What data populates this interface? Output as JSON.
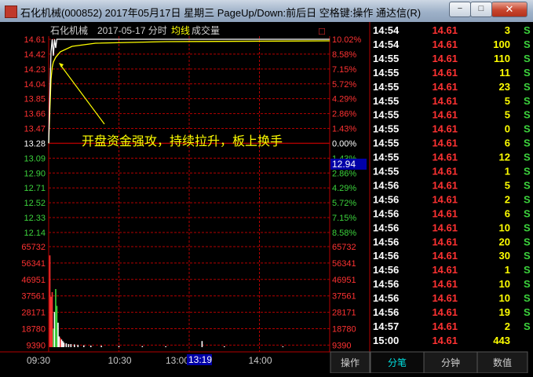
{
  "window": {
    "title": "石化机械(000852) 2017年05月17日 星期三 PageUp/Down:前后日 空格键:操作 通达信(R)",
    "minimize_glyph": "−",
    "maximize_glyph": "□",
    "close_glyph": "✕"
  },
  "chart_header": {
    "stock_name": "石化机械",
    "date_label": "2017-05-17 分时",
    "avg_label": "均线",
    "volume_label": "成交量",
    "close_glyph": "□"
  },
  "price_axis_left": [
    "14.61",
    "14.42",
    "14.23",
    "14.04",
    "13.85",
    "13.66",
    "13.47",
    "13.28",
    "13.09",
    "12.90",
    "12.71",
    "12.52",
    "12.33",
    "12.14"
  ],
  "percent_axis_right": [
    "10.02%",
    "8.58%",
    "7.15%",
    "5.72%",
    "4.29%",
    "2.86%",
    "1.43%",
    "0.00%",
    "1.43%",
    "2.86%",
    "4.29%",
    "5.72%",
    "7.15%",
    "8.58%"
  ],
  "volume_axis_left": [
    "65732",
    "56341",
    "46951",
    "37561",
    "28171",
    "18780",
    "9390"
  ],
  "volume_axis_right": [
    "65732",
    "56341",
    "46951",
    "37561",
    "28171",
    "18780",
    "9390"
  ],
  "time_axis": [
    "09:30",
    "10:30",
    "13:00",
    "14:00"
  ],
  "cursor": {
    "price": "12.94",
    "time": "13:19"
  },
  "annotation": "开盘资金强攻，持续拉升，板上换手",
  "colors": {
    "up": "#ff3232",
    "down": "#3cd23c",
    "grid": "#b40000",
    "price_line": "#ffffff",
    "avg_line": "#ffff00",
    "bull": "#ff3232",
    "flat": "#ffffff",
    "bear": "#3cd23c",
    "cyan": "#00e0e0"
  },
  "chart_data": {
    "type": "line",
    "x_range": [
      "09:30",
      "15:00"
    ],
    "prev_close": 13.28,
    "ylim": [
      11.95,
      14.61
    ],
    "price_series": [
      [
        0,
        13.28
      ],
      [
        1,
        13.9
      ],
      [
        2,
        14.45
      ],
      [
        3,
        14.61
      ],
      [
        4,
        14.4
      ],
      [
        5,
        14.61
      ],
      [
        6,
        14.5
      ],
      [
        7,
        14.61
      ],
      [
        10,
        14.61
      ],
      [
        20,
        14.61
      ],
      [
        240,
        14.61
      ]
    ],
    "avg_series": [
      [
        0,
        13.28
      ],
      [
        1,
        13.7
      ],
      [
        2,
        14.1
      ],
      [
        3,
        14.25
      ],
      [
        4,
        14.32
      ],
      [
        6,
        14.38
      ],
      [
        10,
        14.45
      ],
      [
        20,
        14.52
      ],
      [
        40,
        14.56
      ],
      [
        100,
        14.58
      ],
      [
        240,
        14.59
      ]
    ],
    "volume_ylim": [
      0,
      65732
    ],
    "volume_bars": [
      {
        "t": 1,
        "v": 60000,
        "c": "up"
      },
      {
        "t": 2,
        "v": 33000,
        "c": "up"
      },
      {
        "t": 3,
        "v": 36000,
        "c": "up"
      },
      {
        "t": 4,
        "v": 12000,
        "c": "down"
      },
      {
        "t": 5,
        "v": 23000,
        "c": "flat"
      },
      {
        "t": 6,
        "v": 38000,
        "c": "down"
      },
      {
        "t": 7,
        "v": 27000,
        "c": "down"
      },
      {
        "t": 8,
        "v": 16000,
        "c": "flat"
      },
      {
        "t": 9,
        "v": 7000,
        "c": "flat"
      },
      {
        "t": 10,
        "v": 6000,
        "c": "up"
      },
      {
        "t": 11,
        "v": 5000,
        "c": "flat"
      },
      {
        "t": 12,
        "v": 4000,
        "c": "flat"
      },
      {
        "t": 13,
        "v": 3000,
        "c": "flat"
      },
      {
        "t": 15,
        "v": 2500,
        "c": "flat"
      },
      {
        "t": 17,
        "v": 2000,
        "c": "flat"
      },
      {
        "t": 19,
        "v": 2000,
        "c": "flat"
      },
      {
        "t": 22,
        "v": 1800,
        "c": "flat"
      },
      {
        "t": 25,
        "v": 1500,
        "c": "flat"
      },
      {
        "t": 30,
        "v": 1200,
        "c": "flat"
      },
      {
        "t": 36,
        "v": 1000,
        "c": "flat"
      },
      {
        "t": 45,
        "v": 900,
        "c": "flat"
      },
      {
        "t": 60,
        "v": 800,
        "c": "flat"
      },
      {
        "t": 80,
        "v": 700,
        "c": "flat"
      },
      {
        "t": 100,
        "v": 600,
        "c": "flat"
      },
      {
        "t": 131,
        "v": 4000,
        "c": "flat"
      },
      {
        "t": 150,
        "v": 600,
        "c": "flat"
      },
      {
        "t": 200,
        "v": 500,
        "c": "flat"
      }
    ]
  },
  "ticks": [
    {
      "time": "14:54",
      "price": "14.61",
      "vol": "3",
      "side": "S"
    },
    {
      "time": "14:54",
      "price": "14.61",
      "vol": "100",
      "side": "S"
    },
    {
      "time": "14:55",
      "price": "14.61",
      "vol": "110",
      "side": "S"
    },
    {
      "time": "14:55",
      "price": "14.61",
      "vol": "11",
      "side": "S"
    },
    {
      "time": "14:55",
      "price": "14.61",
      "vol": "23",
      "side": "S"
    },
    {
      "time": "14:55",
      "price": "14.61",
      "vol": "5",
      "side": "S"
    },
    {
      "time": "14:55",
      "price": "14.61",
      "vol": "5",
      "side": "S"
    },
    {
      "time": "14:55",
      "price": "14.61",
      "vol": "0",
      "side": "S"
    },
    {
      "time": "14:55",
      "price": "14.61",
      "vol": "6",
      "side": "S"
    },
    {
      "time": "14:55",
      "price": "14.61",
      "vol": "12",
      "side": "S"
    },
    {
      "time": "14:55",
      "price": "14.61",
      "vol": "1",
      "side": "S"
    },
    {
      "time": "14:56",
      "price": "14.61",
      "vol": "5",
      "side": "S"
    },
    {
      "time": "14:56",
      "price": "14.61",
      "vol": "2",
      "side": "S"
    },
    {
      "time": "14:56",
      "price": "14.61",
      "vol": "6",
      "side": "S"
    },
    {
      "time": "14:56",
      "price": "14.61",
      "vol": "10",
      "side": "S"
    },
    {
      "time": "14:56",
      "price": "14.61",
      "vol": "20",
      "side": "S"
    },
    {
      "time": "14:56",
      "price": "14.61",
      "vol": "30",
      "side": "S"
    },
    {
      "time": "14:56",
      "price": "14.61",
      "vol": "1",
      "side": "S"
    },
    {
      "time": "14:56",
      "price": "14.61",
      "vol": "10",
      "side": "S"
    },
    {
      "time": "14:56",
      "price": "14.61",
      "vol": "10",
      "side": "S"
    },
    {
      "time": "14:56",
      "price": "14.61",
      "vol": "19",
      "side": "S"
    },
    {
      "time": "14:57",
      "price": "14.61",
      "vol": "2",
      "side": "S"
    },
    {
      "time": "15:00",
      "price": "14.61",
      "vol": "443",
      "side": ""
    }
  ],
  "bottom_tabs": [
    {
      "label": "操作",
      "active": false
    },
    {
      "label": "分笔",
      "active": true
    },
    {
      "label": "分钟",
      "active": false
    },
    {
      "label": "数值",
      "active": false
    }
  ]
}
